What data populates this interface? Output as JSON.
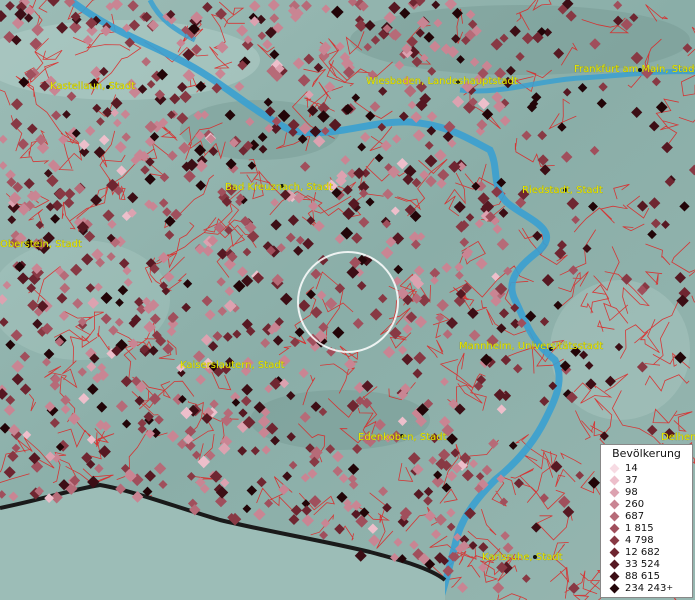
{
  "map": {
    "cities": [
      {
        "name": "Kastellaun, Stadt"
      },
      {
        "name": "Wiesbaden, Landeshauptstadt"
      },
      {
        "name": "Frankfurt am Main, Stadt"
      },
      {
        "name": "Bad Kreuznach, Stadt"
      },
      {
        "name": "Riedstadt, Stadt"
      },
      {
        "name": "Oberstein, Stadt"
      },
      {
        "name": "Kaiserslautern, Stadt"
      },
      {
        "name": "Mannheim, Universitätsstadt"
      },
      {
        "name": "Edenkoben, Stadt"
      },
      {
        "name": "Delhem"
      },
      {
        "name": "Karlsruhe, Stadt"
      }
    ],
    "colors": {
      "terrain": "#8fb3ad",
      "river": "#3aa0d0",
      "boundary": "#e02020",
      "label": "#e8e800"
    }
  },
  "legend": {
    "title": "Bevölkerung",
    "items": [
      {
        "label": "14",
        "color": "#f7dbe3"
      },
      {
        "label": "37",
        "color": "#edbfcb"
      },
      {
        "label": "98",
        "color": "#dca2b0"
      },
      {
        "label": "260",
        "color": "#c98593"
      },
      {
        "label": "687",
        "color": "#b66b78"
      },
      {
        "label": "1 815",
        "color": "#a04f5c"
      },
      {
        "label": "4 798",
        "color": "#883944"
      },
      {
        "label": "12 682",
        "color": "#6f2631"
      },
      {
        "label": "33 524",
        "color": "#561822"
      },
      {
        "label": "88 615",
        "color": "#3c0e15"
      },
      {
        "label": "234 243",
        "color": "#220508",
        "plus": "+"
      }
    ]
  }
}
